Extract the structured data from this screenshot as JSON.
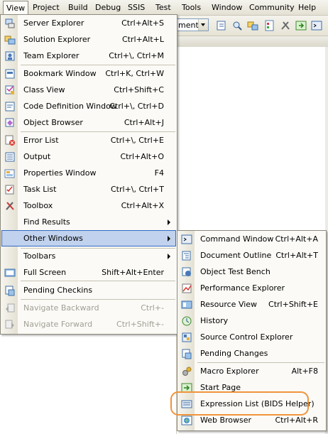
{
  "menubar": {
    "items": [
      "View",
      "Project",
      "Build",
      "Debug",
      "SSIS",
      "Test",
      "Tools",
      "Window",
      "Community",
      "Help"
    ]
  },
  "toolbar": {
    "combo_value": "ment"
  },
  "view_menu": {
    "items": [
      {
        "label": "Server Explorer",
        "shortcut": "Ctrl+Alt+S",
        "icon": "server-explorer-icon"
      },
      {
        "label": "Solution Explorer",
        "shortcut": "Ctrl+Alt+L",
        "icon": "solution-explorer-icon"
      },
      {
        "label": "Team Explorer",
        "shortcut": "Ctrl+\\, Ctrl+M",
        "icon": "team-explorer-icon"
      },
      {
        "label": "Bookmark Window",
        "shortcut": "Ctrl+K, Ctrl+W",
        "icon": "bookmark-icon"
      },
      {
        "label": "Class View",
        "shortcut": "Ctrl+Shift+C",
        "icon": "class-view-icon"
      },
      {
        "label": "Code Definition Window",
        "shortcut": "Ctrl+\\, Ctrl+D",
        "icon": "code-definition-icon"
      },
      {
        "label": "Object Browser",
        "shortcut": "Ctrl+Alt+J",
        "icon": "object-browser-icon"
      },
      {
        "label": "Error List",
        "shortcut": "Ctrl+\\, Ctrl+E",
        "icon": "error-list-icon"
      },
      {
        "label": "Output",
        "shortcut": "Ctrl+Alt+O",
        "icon": "output-icon"
      },
      {
        "label": "Properties Window",
        "shortcut": "F4",
        "icon": "properties-icon"
      },
      {
        "label": "Task List",
        "shortcut": "Ctrl+\\, Ctrl+T",
        "icon": "task-list-icon"
      },
      {
        "label": "Toolbox",
        "shortcut": "Ctrl+Alt+X",
        "icon": "toolbox-icon"
      },
      {
        "label": "Find Results",
        "shortcut": "",
        "icon": ""
      },
      {
        "label": "Other Windows",
        "shortcut": "",
        "icon": ""
      },
      {
        "label": "Toolbars",
        "shortcut": "",
        "icon": ""
      },
      {
        "label": "Full Screen",
        "shortcut": "Shift+Alt+Enter",
        "icon": "full-screen-icon"
      },
      {
        "label": "Pending Checkins",
        "shortcut": "",
        "icon": "pending-checkins-icon"
      },
      {
        "label": "Navigate Backward",
        "shortcut": "Ctrl+-",
        "icon": "navigate-backward-icon"
      },
      {
        "label": "Navigate Forward",
        "shortcut": "Ctrl+Shift+-",
        "icon": "navigate-forward-icon"
      }
    ]
  },
  "other_windows_menu": {
    "items": [
      {
        "label": "Command Window",
        "shortcut": "Ctrl+Alt+A",
        "icon": "command-window-icon"
      },
      {
        "label": "Document Outline",
        "shortcut": "Ctrl+Alt+T",
        "icon": "document-outline-icon"
      },
      {
        "label": "Object Test Bench",
        "shortcut": "",
        "icon": "object-test-bench-icon"
      },
      {
        "label": "Performance Explorer",
        "shortcut": "",
        "icon": "performance-explorer-icon"
      },
      {
        "label": "Resource View",
        "shortcut": "Ctrl+Shift+E",
        "icon": "resource-view-icon"
      },
      {
        "label": "History",
        "shortcut": "",
        "icon": "history-icon"
      },
      {
        "label": "Source Control Explorer",
        "shortcut": "",
        "icon": "source-control-icon"
      },
      {
        "label": "Pending Changes",
        "shortcut": "",
        "icon": "pending-changes-icon"
      },
      {
        "label": "Macro Explorer",
        "shortcut": "Alt+F8",
        "icon": "macro-explorer-icon"
      },
      {
        "label": "Start Page",
        "shortcut": "",
        "icon": "start-page-icon"
      },
      {
        "label": "Expression List (BIDS Helper)",
        "shortcut": "",
        "icon": "expression-list-icon"
      },
      {
        "label": "Web Browser",
        "shortcut": "Ctrl+Alt+R",
        "icon": "web-browser-icon"
      }
    ]
  },
  "colors": {
    "menu_hover": "#c1d2ee",
    "menu_hover_border": "#316ac5",
    "highlight_ring": "#f0943c"
  }
}
